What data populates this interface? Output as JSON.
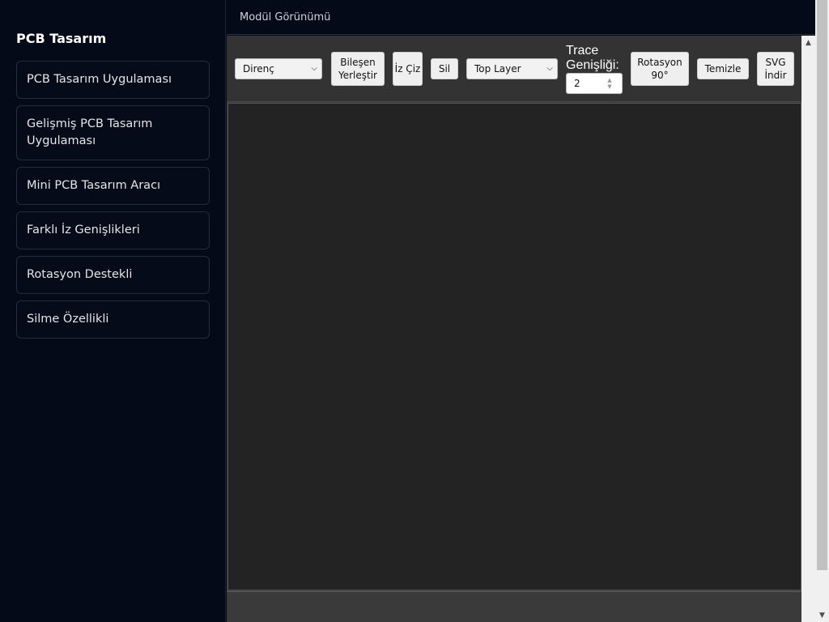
{
  "sidebar": {
    "title": "PCB Tasarım",
    "items": [
      {
        "label": "PCB Tasarım Uygulaması"
      },
      {
        "label": "Gelişmiş PCB Tasarım Uygulaması"
      },
      {
        "label": "Mini PCB Tasarım Aracı"
      },
      {
        "label": "Farklı İz Genişlikleri"
      },
      {
        "label": "Rotasyon Destekli"
      },
      {
        "label": "Silme Özellikli"
      }
    ]
  },
  "header": {
    "title": "Modül Görünümü"
  },
  "toolbar": {
    "component_select": "Direnç",
    "place_button": "Bileşen Yerleştir",
    "draw_trace_button": "İz Çiz",
    "delete_button": "Sil",
    "layer_select": "Top Layer",
    "trace_width_label": "Trace Genişliği:",
    "trace_width_value": "2",
    "rotate_button": "Rotasyon 90°",
    "clear_button": "Temizle",
    "svg_download_button": "SVG İndir"
  },
  "icons": {
    "select_chevron": "chevron-down-icon",
    "spin_up": "chevron-up-icon",
    "spin_down": "chevron-down-icon",
    "scroll_up": "scroll-up-arrow-icon",
    "scroll_down": "scroll-down-arrow-icon"
  },
  "colors": {
    "page_background": "#050a18",
    "toolbar_background": "#333333",
    "canvas_background": "#232323",
    "button_background": "#efefef"
  }
}
